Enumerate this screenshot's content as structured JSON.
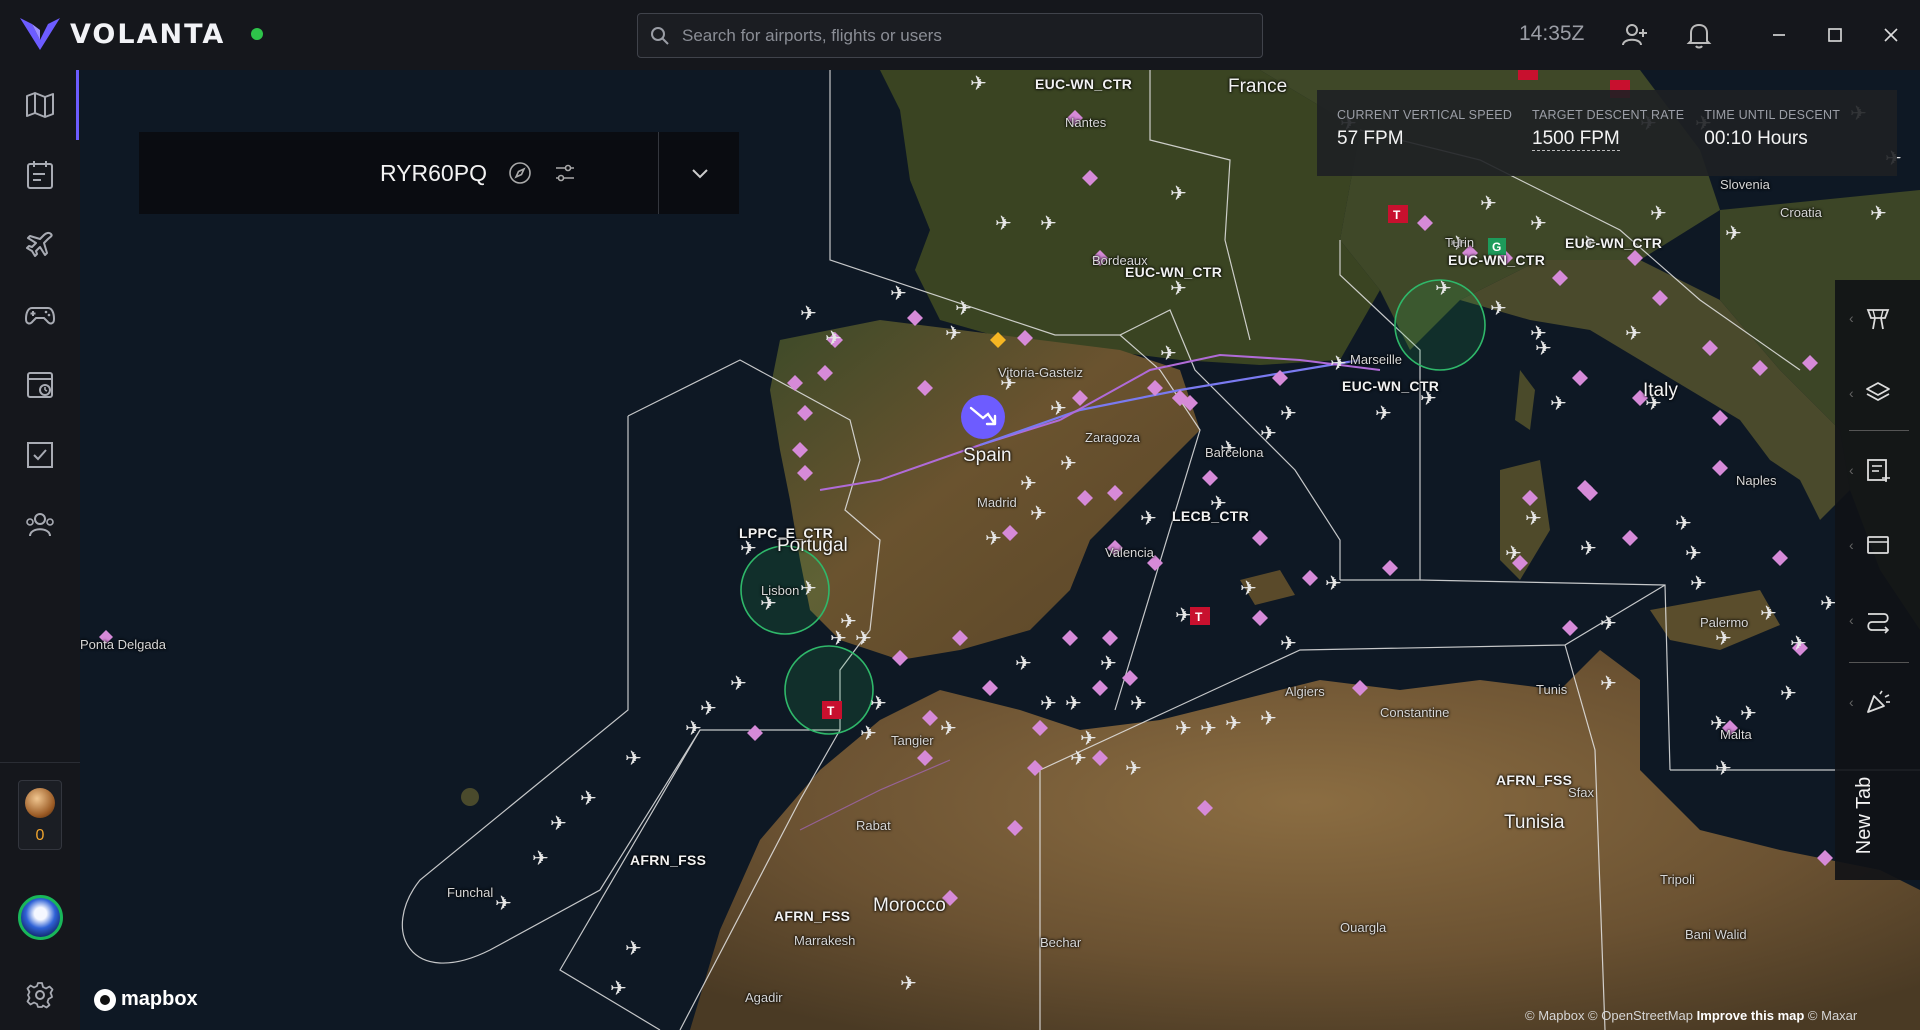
{
  "app": {
    "name": "VOLANTA",
    "clock": "14:35Z",
    "search_placeholder": "Search for airports, flights or users",
    "brand_color": "#6d5cff",
    "status_color": "#2ec44a"
  },
  "sidebar": {
    "items": [
      {
        "name": "map-icon"
      },
      {
        "name": "flight-log-icon"
      },
      {
        "name": "plane-icon"
      },
      {
        "name": "gamepad-icon"
      },
      {
        "name": "scheduler-icon"
      },
      {
        "name": "checklist-icon"
      },
      {
        "name": "users-icon"
      }
    ],
    "points": "0"
  },
  "flight_panel": {
    "callsign": "RYR60PQ"
  },
  "stats": {
    "vertical_speed_label": "CURRENT VERTICAL SPEED",
    "vertical_speed_value": "57 FPM",
    "descent_rate_label": "TARGET DESCENT RATE",
    "descent_rate_value": "1500 FPM",
    "time_to_descent_label": "TIME UNTIL DESCENT",
    "time_to_descent_value": "00:10 Hours"
  },
  "right_toolbar": {
    "new_tab": "New Tab"
  },
  "map": {
    "countries": [
      "France",
      "Spain",
      "Portugal",
      "Italy",
      "Morocco",
      "Tunisia",
      "Croatia"
    ],
    "sectors": [
      "EUC-WN_CTR",
      "EUC-WN_CTR",
      "EUC-WN_CTR",
      "EUC-WN_CTR",
      "EUC-WN_CTR",
      "LPPC_E_CTR",
      "LECB_CTR",
      "AFRN_FSS",
      "AFRN_FSS",
      "AFRN_FSS"
    ],
    "cities": [
      "Bordeaux",
      "Nantes",
      "Vitoria-Gasteiz",
      "Zaragoza",
      "Barcelona",
      "Madrid",
      "Valencia",
      "Lisbon",
      "Tangier",
      "Rabat",
      "Marrakesh",
      "Funchal",
      "Ponta Delgada",
      "Constantine",
      "Tunis",
      "Sfax",
      "Tripoli",
      "Naples",
      "Palermo",
      "Malta",
      "Slovenia",
      "Algiers",
      "Ouargla",
      "Bechar",
      "Bani Walid",
      "Agadir",
      "Marseille",
      "Turin"
    ],
    "mapbox": "mapbox",
    "attribution_a": "© Mapbox © OpenStreetMap",
    "attribution_b": "Improve this map",
    "attribution_c": "© Maxar"
  }
}
